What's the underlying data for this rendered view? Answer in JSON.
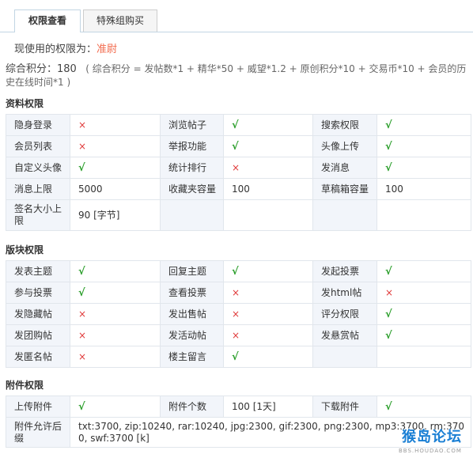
{
  "tabs": [
    {
      "label": "权限查看",
      "active": true
    },
    {
      "label": "特殊组购买",
      "active": false
    }
  ],
  "current": {
    "label": "现使用的权限为：",
    "level": "准尉"
  },
  "score": {
    "label": "综合积分：",
    "value": "180",
    "formula": "( 综合积分 = 发帖数*1 + 精华*50 + 威望*1.2 + 原创积分*10 + 交易币*10 + 会员的历史在线时间*1 )"
  },
  "sections": [
    {
      "title": "资料权限",
      "rows": [
        [
          {
            "k": "隐身登录",
            "v": "no"
          },
          {
            "k": "浏览帖子",
            "v": "yes"
          },
          {
            "k": "搜索权限",
            "v": "yes"
          }
        ],
        [
          {
            "k": "会员列表",
            "v": "no"
          },
          {
            "k": "举报功能",
            "v": "yes"
          },
          {
            "k": "头像上传",
            "v": "yes"
          }
        ],
        [
          {
            "k": "自定义头像",
            "v": "yes"
          },
          {
            "k": "统计排行",
            "v": "no"
          },
          {
            "k": "发消息",
            "v": "yes"
          }
        ],
        [
          {
            "k": "消息上限",
            "v": "5000"
          },
          {
            "k": "收藏夹容量",
            "v": "100"
          },
          {
            "k": "草稿箱容量",
            "v": "100"
          }
        ],
        [
          {
            "k": "签名大小上限",
            "v": "90 [字节]"
          },
          {
            "k": "",
            "v": ""
          },
          {
            "k": "",
            "v": ""
          }
        ]
      ]
    },
    {
      "title": "版块权限",
      "rows": [
        [
          {
            "k": "发表主题",
            "v": "yes"
          },
          {
            "k": "回复主题",
            "v": "yes"
          },
          {
            "k": "发起投票",
            "v": "yes"
          }
        ],
        [
          {
            "k": "参与投票",
            "v": "yes"
          },
          {
            "k": "查看投票",
            "v": "no"
          },
          {
            "k": "发html帖",
            "v": "no"
          }
        ],
        [
          {
            "k": "发隐藏帖",
            "v": "no"
          },
          {
            "k": "发出售帖",
            "v": "no"
          },
          {
            "k": "评分权限",
            "v": "yes"
          }
        ],
        [
          {
            "k": "发团购帖",
            "v": "no"
          },
          {
            "k": "发活动帖",
            "v": "no"
          },
          {
            "k": "发悬赏帖",
            "v": "yes"
          }
        ],
        [
          {
            "k": "发匿名帖",
            "v": "no"
          },
          {
            "k": "楼主留言",
            "v": "yes"
          },
          {
            "k": "",
            "v": ""
          }
        ]
      ]
    },
    {
      "title": "附件权限",
      "rows": [
        [
          {
            "k": "上传附件",
            "v": "yes"
          },
          {
            "k": "附件个数",
            "v": "100 [1天]"
          },
          {
            "k": "下载附件",
            "v": "yes"
          }
        ]
      ],
      "ext": {
        "k": "附件允许后缀",
        "v": "txt:3700, zip:10240, rar:10240, jpg:2300, gif:2300, png:2300, mp3:3700, rm:3700, swf:3700 [k]"
      }
    }
  ],
  "symbols": {
    "yes": "√",
    "no": "×"
  },
  "watermark": {
    "logo": "猴岛论坛",
    "url": "BBS.HOUDAO.COM"
  }
}
